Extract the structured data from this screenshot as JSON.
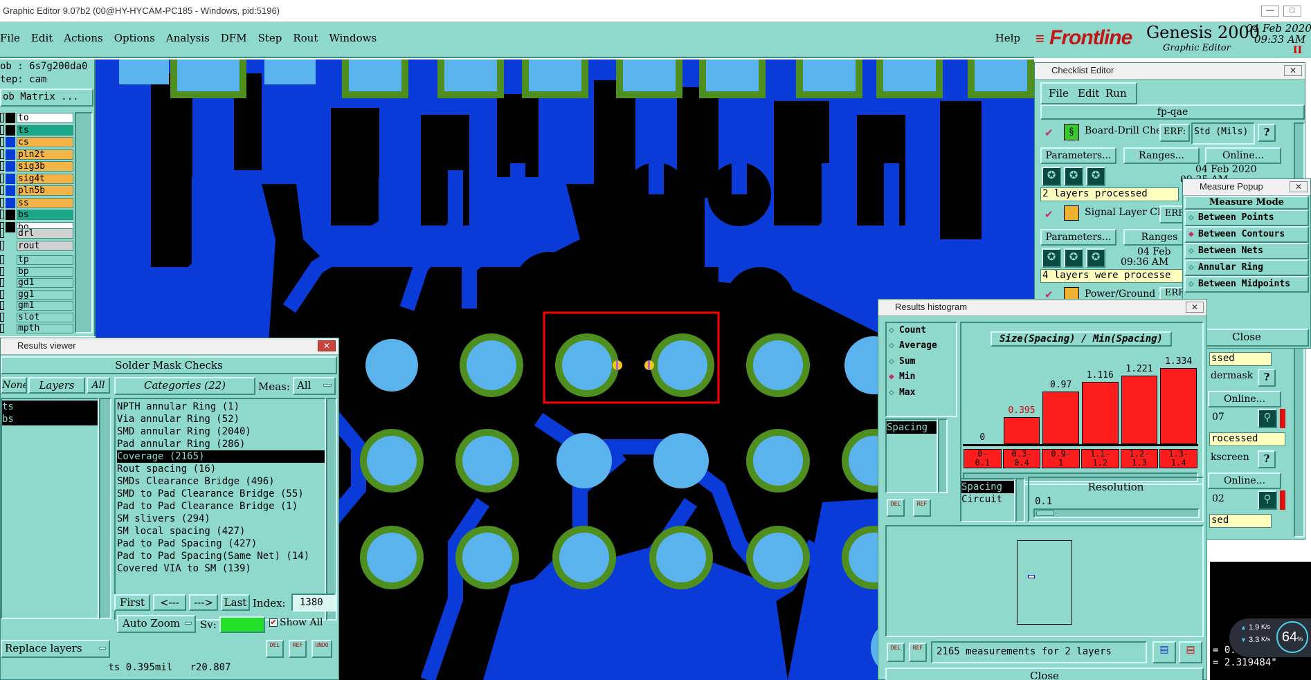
{
  "window": {
    "title": "Graphic Editor 9.07b2 (00@HY-HYCAM-PC185 - Windows, pid:5196)"
  },
  "menu": {
    "items": [
      "File",
      "Edit",
      "Actions",
      "Options",
      "Analysis",
      "DFM",
      "Step",
      "Rout",
      "Windows"
    ],
    "help": "Help"
  },
  "brand": {
    "logo": "Frontline",
    "product": "Genesis 2000",
    "subtitle": "Graphic Editor",
    "date": "04 Feb 2020",
    "time": "09:33 AM",
    "pause": "II"
  },
  "job": {
    "job_label": "ob : 6s7g200da0",
    "step_label": "tep: cam",
    "matrix_button": "ob Matrix ..."
  },
  "layers": {
    "board": [
      {
        "name": "to",
        "bg": "#ffffff"
      },
      {
        "name": "ts",
        "bg": "#1aa889"
      },
      {
        "name": "cs",
        "bg": "#f5b447"
      },
      {
        "name": "pln2t",
        "bg": "#f5b447"
      },
      {
        "name": "sig3b",
        "bg": "#f5b447"
      },
      {
        "name": "sig4t",
        "bg": "#f5b447"
      },
      {
        "name": "pln5b",
        "bg": "#f5b447"
      },
      {
        "name": "ss",
        "bg": "#f5b447"
      },
      {
        "name": "bs",
        "bg": "#1aa889"
      },
      {
        "name": "bo",
        "bg": "#ffffff"
      }
    ],
    "drill": [
      "drl",
      "rout"
    ],
    "misc": [
      "tp",
      "bp",
      "gd1",
      "gg1",
      "gm1",
      "slot",
      "mpth"
    ]
  },
  "results_viewer": {
    "title": "Results viewer",
    "header": "Solder Mask Checks",
    "none_button": "None",
    "layers_button": "Layers",
    "all_button": "All",
    "categories_label": "Categories (22)",
    "meas_label": "Meas:",
    "meas_value": "All",
    "left_list": [
      "ts",
      "bs"
    ],
    "categories": [
      "NPTH annular Ring (1)",
      "Via annular Ring (52)",
      "SMD annular Ring (2040)",
      "Pad annular Ring (286)",
      "Coverage (2165)",
      "Rout spacing (16)",
      "SMDs Clearance Bridge (496)",
      "SMD to Pad Clearance Bridge (55)",
      "Pad to Pad Clearance Bridge (1)",
      "SM slivers (294)",
      "SM local spacing (427)",
      "Pad to Pad Spacing (427)",
      "Pad to Pad Spacing(Same Net) (14)",
      "Covered VIA to SM (139)"
    ],
    "selected_index": 4,
    "nav": {
      "first": "First",
      "prev": "<---",
      "next": "--->",
      "last": "Last",
      "index_label": "Index:",
      "index_value": "1380"
    },
    "auto_zoom": "Auto Zoom",
    "sv_label": "Sv:",
    "show_all": "Show All",
    "replace_layers": "Replace layers",
    "status": "ts 0.395mil   r20.807",
    "icons": [
      "DEL",
      "REF",
      "UNDO"
    ]
  },
  "checklist": {
    "title": "Checklist Editor",
    "menu": [
      "File",
      "Edit",
      "Run"
    ],
    "name": "fp-qae",
    "items": [
      {
        "name": "Board-Drill Che",
        "erf_label": "ERF:",
        "erf_value": "Std (Mils)",
        "params": "Parameters...",
        "ranges": "Ranges...",
        "online": "Online...",
        "date": "04 Feb 2020",
        "time": "09:35 AM -",
        "status": "2 layers processed"
      },
      {
        "name": "Signal Layer Ch",
        "erf_label": "ERF",
        "params": "Parameters...",
        "ranges": "Ranges",
        "date": "04 Feb",
        "time": "09:36 AM",
        "status": "4 layers were processe"
      },
      {
        "name": "Power/Ground C",
        "erf_label": "ERF"
      }
    ],
    "right_fragments": [
      "ssed",
      "dermask",
      "Online...",
      "07",
      "rocessed",
      "kscreen",
      "Online...",
      "02",
      "sed"
    ]
  },
  "measure": {
    "title": "Measure Popup",
    "header": "Measure Mode",
    "modes": [
      "Between Points",
      "Between Contours",
      "Between Nets",
      "Annular Ring",
      "Between Midpoints"
    ],
    "selected": 1,
    "close": "Close"
  },
  "histogram": {
    "title": "Results histogram",
    "options": [
      "Count",
      "Average",
      "Sum",
      "Min",
      "Max"
    ],
    "selected_option": 3,
    "chart_title": "Size(Spacing) / Min(Spacing)",
    "bar_values": [
      "0",
      "0.395",
      "0.97",
      "1.116",
      "1.221",
      "1.334"
    ],
    "bar_levels": [
      0,
      0.28,
      0.55,
      0.65,
      0.72,
      0.8
    ],
    "bar_value_colors": [
      "#000000",
      "#e00000",
      "#000000",
      "#000000",
      "#000000",
      "#000000"
    ],
    "bins": [
      [
        "0-",
        "0.1"
      ],
      [
        "0.3-",
        "0.4"
      ],
      [
        "0.9-",
        "1"
      ],
      [
        "1.1-",
        "1.2"
      ],
      [
        "1.2-",
        "1.3"
      ],
      [
        "1.3-",
        "1.4"
      ]
    ],
    "measures_list": [
      "Spacing"
    ],
    "group_list": [
      "Spacing",
      "Circuit"
    ],
    "resolution_label": "Resolution",
    "resolution_value": "0.1",
    "summary": "2165 measurements for 2 layers",
    "close": "Close",
    "icons": [
      "DEL",
      "REF"
    ]
  },
  "coords": {
    "x": "= 0.33146\"",
    "y": "= 2.319484\""
  },
  "net_widget": {
    "up": "1.9",
    "down": "3.3",
    "unit": "K/s",
    "percent": "64",
    "percent_sign": "%"
  },
  "colors": {
    "teal": "#8fd8cc",
    "canvas_bg": "#000000",
    "copper": "#0a3bd8",
    "pad": "#5bb3ee",
    "ring": "#4f8f1f",
    "highlight": "#ff0000"
  }
}
